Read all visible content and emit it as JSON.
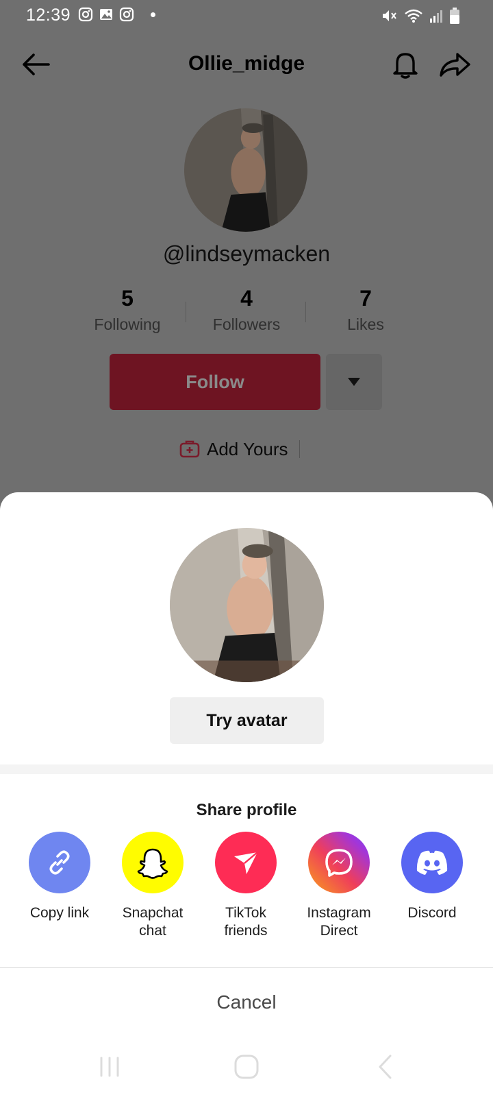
{
  "status_bar": {
    "time": "12:39",
    "left_icons": [
      "instagram-icon",
      "gallery-icon",
      "instagram-icon",
      "notification-dot"
    ],
    "right_icons": [
      "mute-icon",
      "wifi-icon",
      "signal-icon",
      "battery-icon"
    ]
  },
  "header": {
    "title": "Ollie_midge",
    "back_icon": "back-arrow-icon",
    "bell_icon": "bell-icon",
    "share_icon": "share-icon"
  },
  "profile": {
    "handle": "@lindseymacken",
    "stats": [
      {
        "value": "5",
        "label": "Following"
      },
      {
        "value": "4",
        "label": "Followers"
      },
      {
        "value": "7",
        "label": "Likes"
      }
    ],
    "follow_label": "Follow",
    "add_yours_label": "Add Yours",
    "ellipsis": "..."
  },
  "sheet": {
    "try_avatar_label": "Try avatar",
    "share_title": "Share profile",
    "share_targets": [
      {
        "label": "Copy link",
        "icon": "link-icon",
        "color": "#6f86f0"
      },
      {
        "label": "Snapchat\nchat",
        "icon": "snapchat-icon",
        "color": "#fffc00"
      },
      {
        "label": "TikTok\nfriends",
        "icon": "send-icon",
        "color": "#fe2c55"
      },
      {
        "label": "Instagram\nDirect",
        "icon": "messenger-icon",
        "color": "#dd2a7b"
      },
      {
        "label": "Discord",
        "icon": "discord-icon",
        "color": "#5865f2"
      }
    ],
    "cancel_label": "Cancel"
  },
  "colors": {
    "follow_dimmed": "#6e1422",
    "overlay": "#6f6f6f",
    "tiktok_red": "#fe2c55"
  }
}
